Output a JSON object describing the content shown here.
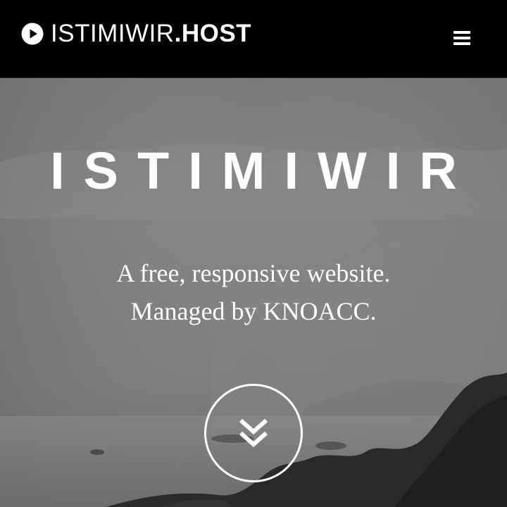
{
  "navbar": {
    "brand_name": "ISTIMIWIR",
    "brand_tld": ".HOST",
    "brand_icon": "play-circle-icon",
    "menu_icon": "hamburger-menu-icon"
  },
  "hero": {
    "title": "ISTIMIWIR",
    "subtitle_line1": "A free, responsive website.",
    "subtitle_line2": "Managed by KNOACC.",
    "scroll_icon": "double-chevron-down-icon"
  },
  "colors": {
    "navbar_background": "#000000",
    "text": "#ffffff",
    "hero_tint": "#7d7d7d"
  }
}
